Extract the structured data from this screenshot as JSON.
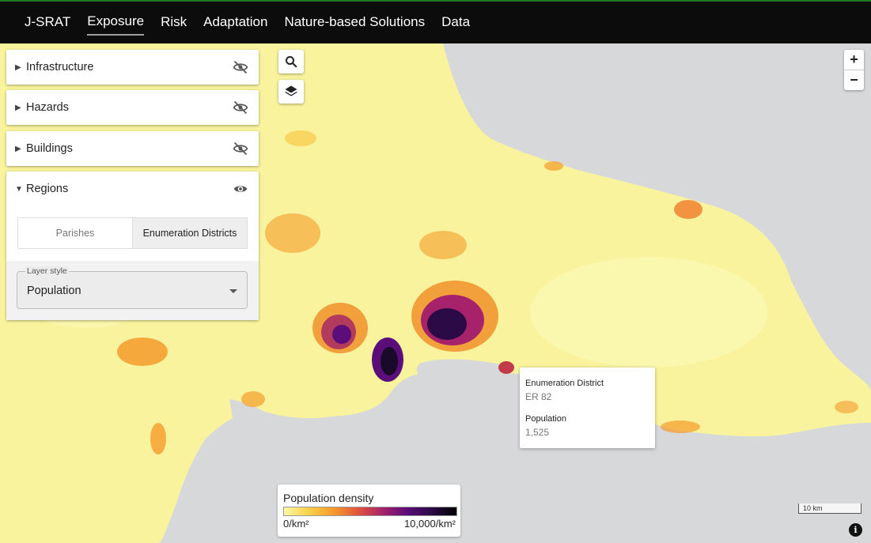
{
  "nav": {
    "items": [
      {
        "label": "J-SRAT",
        "active": false
      },
      {
        "label": "Exposure",
        "active": true
      },
      {
        "label": "Risk",
        "active": false
      },
      {
        "label": "Adaptation",
        "active": false
      },
      {
        "label": "Nature-based Solutions",
        "active": false
      },
      {
        "label": "Data",
        "active": false
      }
    ]
  },
  "sidebar": {
    "panels": [
      {
        "title": "Infrastructure",
        "expanded": false,
        "visible": false,
        "icon": "eye-off-icon"
      },
      {
        "title": "Hazards",
        "expanded": false,
        "visible": false,
        "icon": "eye-off-icon"
      },
      {
        "title": "Buildings",
        "expanded": false,
        "visible": false,
        "icon": "eye-off-icon"
      },
      {
        "title": "Regions",
        "expanded": true,
        "visible": true,
        "icon": "eye-icon"
      }
    ],
    "regions": {
      "toggle_options": [
        "Parishes",
        "Enumeration Districts"
      ],
      "selected_option": "Enumeration Districts",
      "layer_style_label": "Layer style",
      "layer_style_value": "Population"
    }
  },
  "map_controls": {
    "search_icon": "search-icon",
    "layers_icon": "layers-icon",
    "zoom_in_label": "+",
    "zoom_out_label": "−",
    "info_label": "i"
  },
  "tooltip": {
    "district_label": "Enumeration District",
    "district_value": "ER 82",
    "population_label": "Population",
    "population_value": "1,525"
  },
  "legend": {
    "title": "Population density",
    "min_label": "0/km²",
    "max_label": "10,000/km²",
    "colors": [
      "#fbf7a3",
      "#f9d14a",
      "#f59b2b",
      "#e1553c",
      "#a6226a",
      "#5b0d79",
      "#000000"
    ]
  },
  "scale_bar": {
    "label": "10 km"
  },
  "colors": {
    "land": "#f8f39c",
    "sea": "#d6d8da",
    "topbar": "#0c0c0c"
  }
}
